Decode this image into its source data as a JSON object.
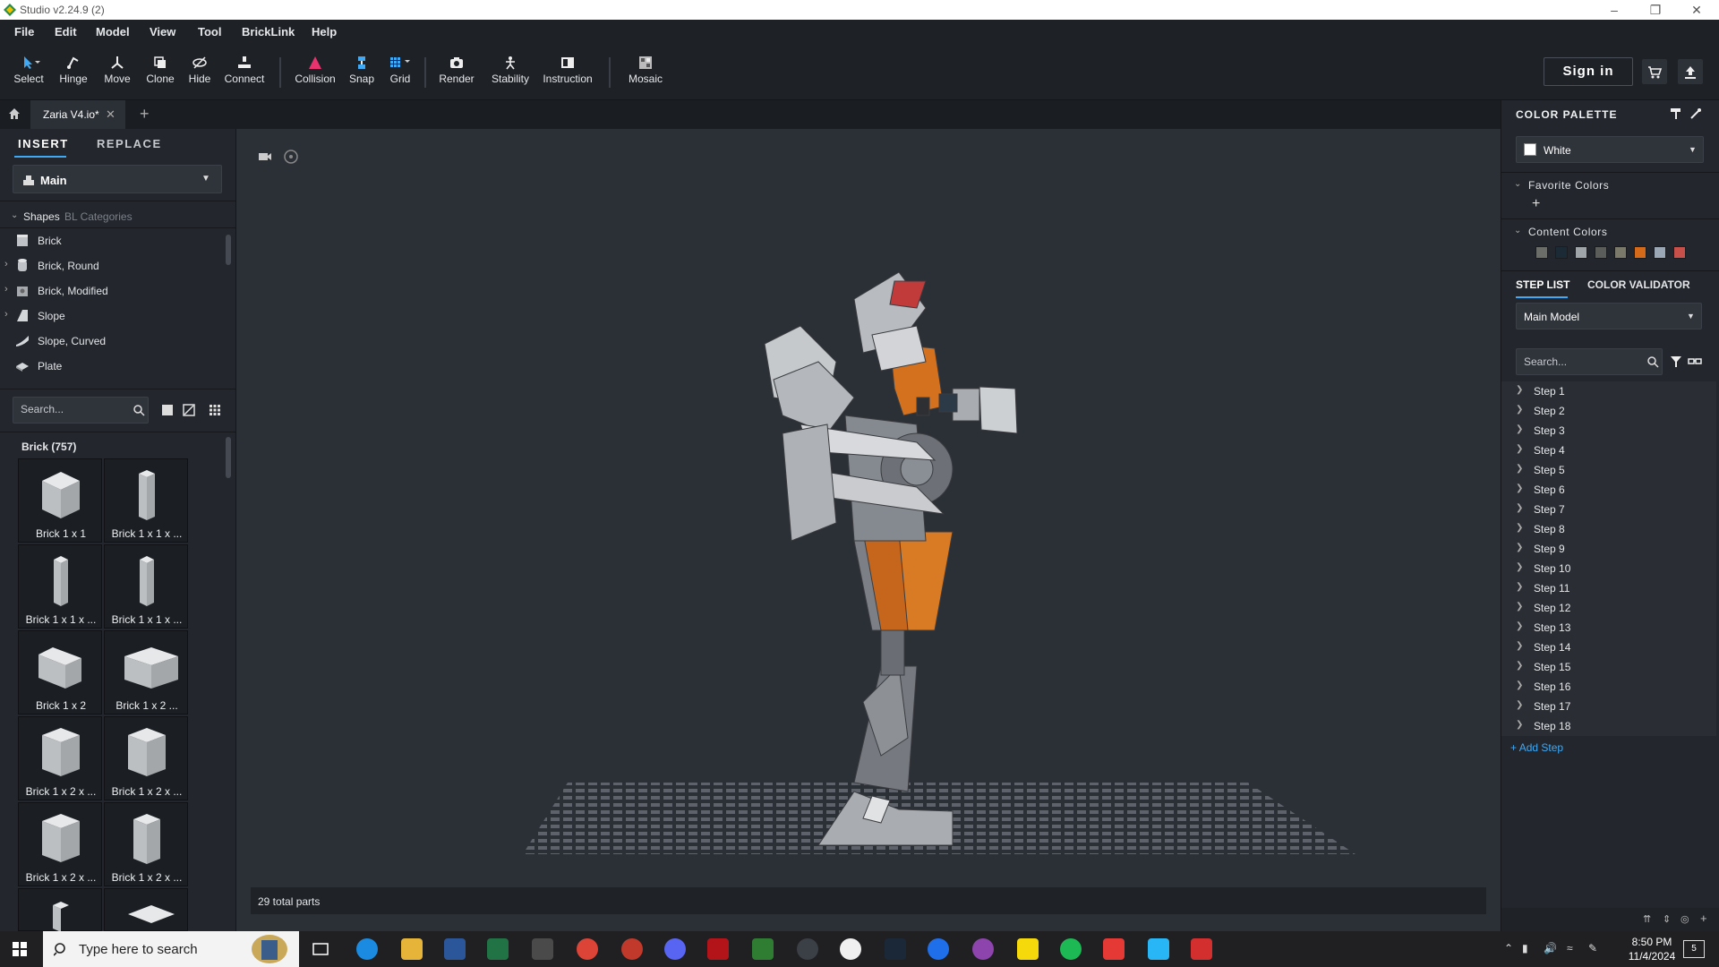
{
  "window": {
    "title": "Studio v2.24.9 (2)",
    "controls": [
      "minimize-icon",
      "restore-icon",
      "close-icon"
    ]
  },
  "menu": [
    "File",
    "Edit",
    "Model",
    "View",
    "Tool",
    "BrickLink",
    "Help"
  ],
  "toolbar": {
    "tools": [
      {
        "label": "Select",
        "icon": "cursor-icon"
      },
      {
        "label": "Hinge",
        "icon": "hinge-icon"
      },
      {
        "label": "Move",
        "icon": "move-icon"
      },
      {
        "label": "Clone",
        "icon": "clone-icon"
      },
      {
        "label": "Hide",
        "icon": "hide-icon"
      },
      {
        "label": "Connect",
        "icon": "connect-icon"
      },
      {
        "label": "Collision",
        "icon": "collision-icon"
      },
      {
        "label": "Snap",
        "icon": "snap-icon"
      },
      {
        "label": "Grid",
        "icon": "grid-icon"
      },
      {
        "label": "Render",
        "icon": "camera-icon"
      },
      {
        "label": "Stability",
        "icon": "stability-icon"
      },
      {
        "label": "Instruction",
        "icon": "instruction-icon"
      },
      {
        "label": "Mosaic",
        "icon": "mosaic-icon"
      }
    ],
    "sign_in": "Sign in"
  },
  "tabs": {
    "document": "Zaria V4.io*"
  },
  "left_panel": {
    "tabs": [
      "INSERT",
      "REPLACE"
    ],
    "palette_select": "Main",
    "filter_tabs": [
      "Shapes",
      "BL Categories"
    ],
    "categories": [
      "Brick",
      "Brick, Round",
      "Brick, Modified",
      "Slope",
      "Slope, Curved",
      "Plate"
    ],
    "search_placeholder": "Search...",
    "group_header": "Brick (757)",
    "parts": [
      "Brick 1 x 1",
      "Brick 1 x 1 x ...",
      "Brick 1 x 1 x ...",
      "Brick 1 x 1 x ...",
      "Brick 1 x 2",
      "Brick 1 x 2 ...",
      "Brick 1 x 2 x ...",
      "Brick 1 x 2 x ...",
      "Brick 1 x 2 x ...",
      "Brick 1 x 2 x ..."
    ]
  },
  "viewport": {
    "status": "29 total parts"
  },
  "right_panel": {
    "color_palette_title": "COLOR PALETTE",
    "selected_color": "White",
    "favorite_colors_label": "Favorite Colors",
    "content_colors_label": "Content Colors",
    "content_colors": [
      "#6b6e68",
      "#1b2a34",
      "#a0a5a9",
      "#5b5d5a",
      "#7b7a6a",
      "#d46a1a",
      "#9ba7b4",
      "#c8504a"
    ],
    "tabs": [
      "STEP LIST",
      "COLOR VALIDATOR"
    ],
    "model_select": "Main Model",
    "search_placeholder": "Search...",
    "steps": [
      "Step 1",
      "Step 2",
      "Step 3",
      "Step 4",
      "Step 5",
      "Step 6",
      "Step 7",
      "Step 8",
      "Step 9",
      "Step 10",
      "Step 11",
      "Step 12",
      "Step 13",
      "Step 14",
      "Step 15",
      "Step 16",
      "Step 17",
      "Step 18"
    ],
    "add_step": "Add Step"
  },
  "taskbar": {
    "search_placeholder": "Type here to search",
    "time": "8:50 PM",
    "date": "11/4/2024",
    "notification_count": "5"
  }
}
